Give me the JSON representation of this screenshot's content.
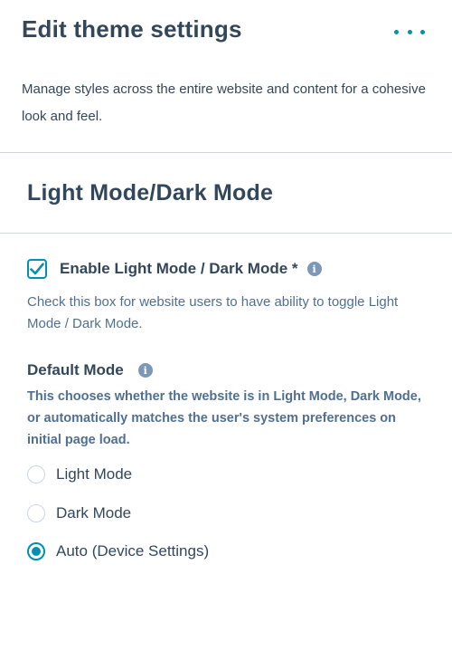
{
  "header": {
    "title": "Edit theme settings",
    "description": "Manage styles across the entire website and content for a cohesive look and feel.",
    "more_icon": "more-horizontal-icon"
  },
  "section": {
    "title": "Light Mode/Dark Mode"
  },
  "enable_toggle": {
    "checked": true,
    "label": "Enable Light Mode / Dark Mode *",
    "info_icon": "info-icon",
    "help": "Check this box for website users to have ability to toggle Light Mode / Dark Mode."
  },
  "default_mode": {
    "label": "Default Mode",
    "info_icon": "info-icon",
    "help": "This chooses whether the website is in Light Mode, Dark Mode, or automatically matches the user's system preferences on initial page load.",
    "options": [
      {
        "label": "Light Mode",
        "selected": false
      },
      {
        "label": "Dark Mode",
        "selected": false
      },
      {
        "label": "Auto (Device Settings)",
        "selected": true
      }
    ]
  },
  "colors": {
    "accent": "#0091ae",
    "text": "#33475b",
    "muted_text": "#516f90",
    "border": "#cbd6e2",
    "info_icon_bg": "#7c98b6"
  }
}
